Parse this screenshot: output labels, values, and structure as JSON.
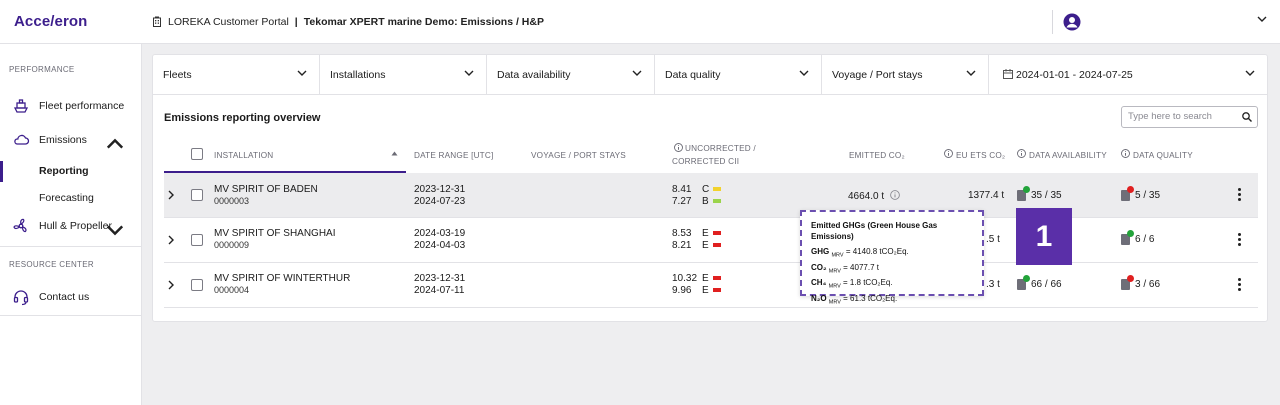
{
  "brand": {
    "logo": "Acce/eron"
  },
  "breadcrumb": {
    "portal": "LOREKA Customer Portal",
    "sep": "|",
    "page": "Tekomar XPERT marine Demo: Emissions / H&P"
  },
  "sidebar": {
    "section_performance": "PERFORMANCE",
    "fleet_performance": "Fleet performance",
    "emissions": "Emissions",
    "reporting": "Reporting",
    "forecasting": "Forecasting",
    "hull_propeller": "Hull & Propeller",
    "section_resource": "RESOURCE CENTER",
    "contact_us": "Contact us"
  },
  "filters": [
    {
      "label": "Fleets"
    },
    {
      "label": "Installations"
    },
    {
      "label": "Data availability"
    },
    {
      "label": "Data quality"
    },
    {
      "label": "Voyage / Port stays"
    },
    {
      "label": "2024-01-01 - 2024-07-25"
    }
  ],
  "table": {
    "title": "Emissions reporting overview",
    "search_placeholder": "Type here to search",
    "headers": {
      "installation": "INSTALLATION",
      "date_range": "DATE RANGE [UTC]",
      "voyage": "VOYAGE / PORT STAYS",
      "cii": "UNCORRECTED /",
      "cii2": "CORRECTED CII",
      "emitted": "EMITTED CO₂",
      "eu_ets": "EU ETS CO₂",
      "availability": "DATA AVAILABILITY",
      "quality": "DATA QUALITY"
    },
    "rows": [
      {
        "name": "MV SPIRIT OF BADEN",
        "id": "0000003",
        "date_from": "2023-12-31",
        "date_to": "2024-07-23",
        "cii_u": "8.41",
        "cii_u_grade": "C",
        "cii_u_color": "#f2d22c",
        "cii_c": "7.27",
        "cii_c_grade": "B",
        "cii_c_color": "#9bd44b",
        "emitted": "4664.0 t",
        "eu_ets": "1377.4 t",
        "availability": "35 / 35",
        "avail_color": "#22a33a",
        "quality": "5 / 35",
        "quality_color": "#e02020"
      },
      {
        "name": "MV SPIRIT OF SHANGHAI",
        "id": "0000009",
        "date_from": "2024-03-19",
        "date_to": "2024-04-03",
        "cii_u": "8.53",
        "cii_u_grade": "E",
        "cii_u_color": "#e02020",
        "cii_c": "8.21",
        "cii_c_grade": "E",
        "cii_c_color": "#e02020",
        "eu_ets": ".5 t",
        "quality": "6 / 6",
        "quality_color": "#22a33a"
      },
      {
        "name": "MV SPIRIT OF WINTERTHUR",
        "id": "0000004",
        "date_from": "2023-12-31",
        "date_to": "2024-07-11",
        "cii_u": "10.32",
        "cii_u_grade": "E",
        "cii_u_color": "#e02020",
        "cii_c": "9.96",
        "cii_c_grade": "E",
        "cii_c_color": "#e02020",
        "eu_ets": ".3 t",
        "availability": "66 / 66",
        "avail_color": "#22a33a",
        "quality": "3 / 66",
        "quality_color": "#e02020"
      }
    ]
  },
  "tooltip": {
    "title": "Emitted GHGs (Green House Gas Emissions)",
    "ghg_label": "GHG",
    "ghg_value": "= 4140.8 tCO₂Eq.",
    "co2_label": "CO₂",
    "co2_value": "= 4077.7 t",
    "ch4_label": "CH₄",
    "ch4_value": "= 1.8 tCO₂Eq.",
    "n2o_label": "N₂O",
    "n2o_value": "= 61.3 tCO₂Eq.",
    "mrv": "MRV"
  },
  "annotation": {
    "number": "1"
  },
  "colors": {
    "brand": "#3c1e8c",
    "annotation": "#5a2fa8"
  }
}
